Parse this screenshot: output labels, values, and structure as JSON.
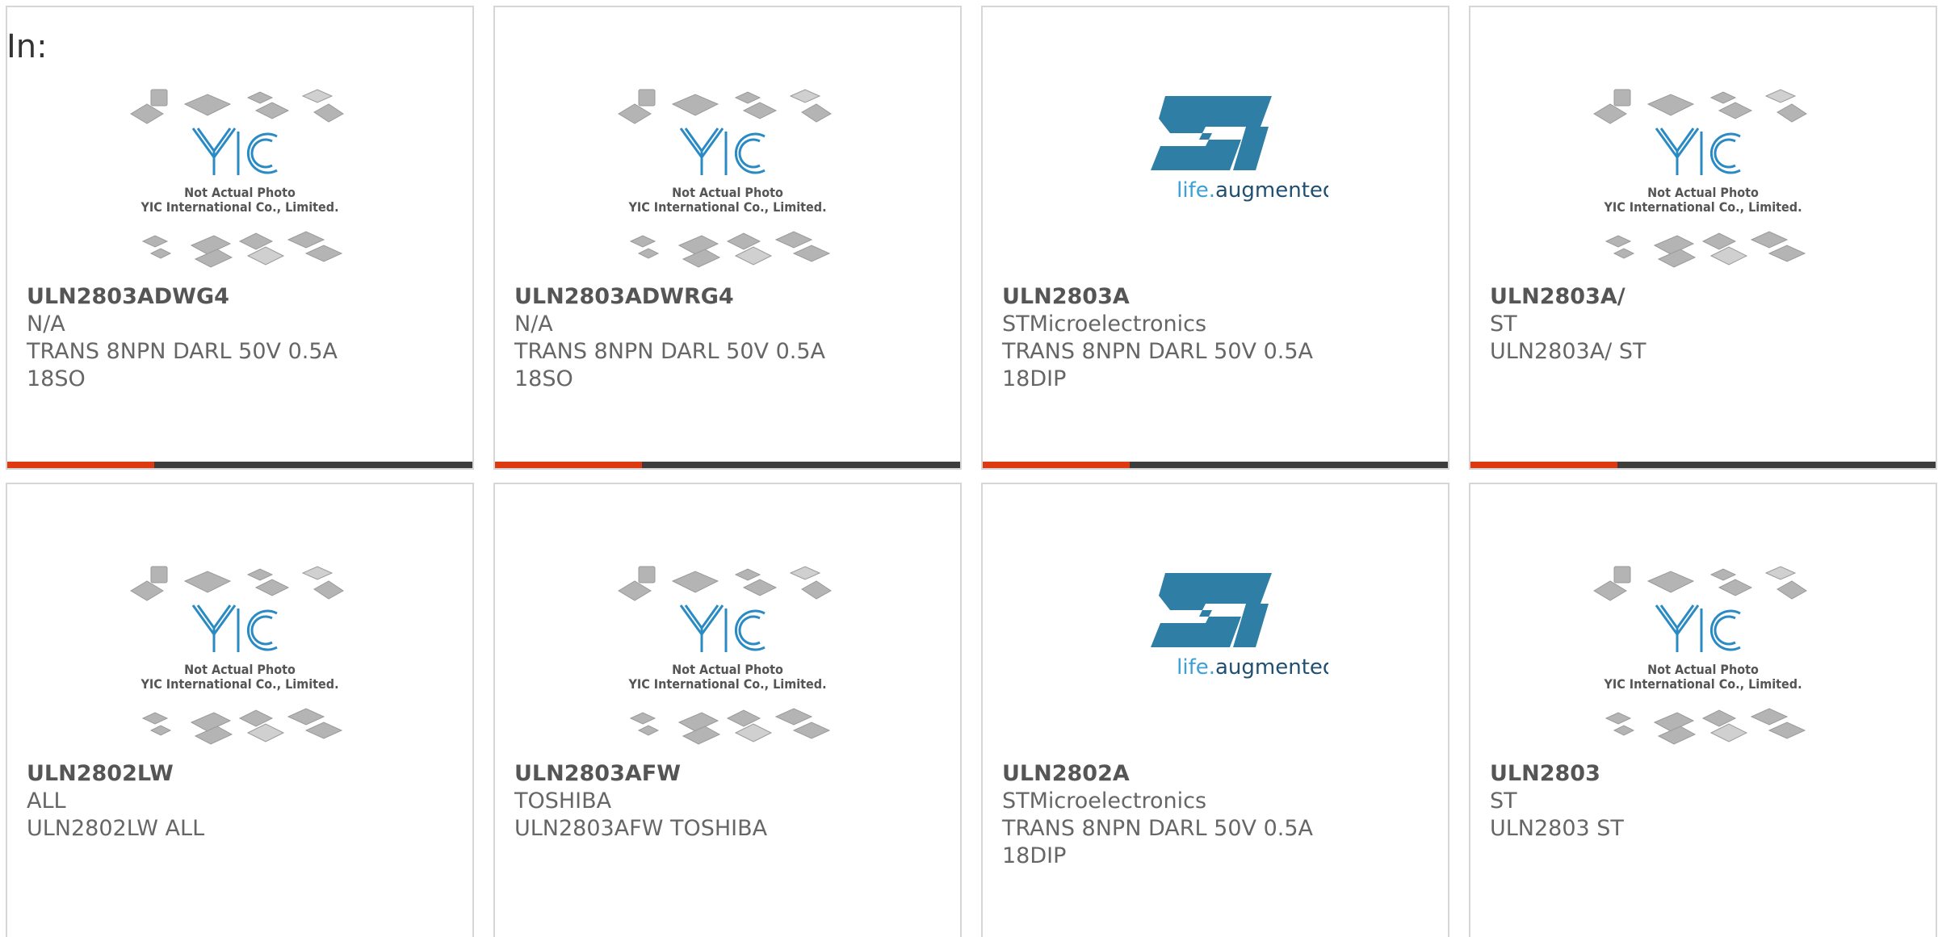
{
  "heading": "In:",
  "placeholder": {
    "brand": "YIC",
    "line1": "Not Actual Photo",
    "line2": "YIC International Co., Limited."
  },
  "st_logo": {
    "brand": "ST",
    "tagline_a": "life.",
    "tagline_b": "augmented"
  },
  "colors": {
    "accent": "#de3a12",
    "bar": "#3d3d3d",
    "st_blue": "#2f7ea5",
    "yic_blue": "#2a8ac4"
  },
  "products": [
    {
      "part": "ULN2803ADWG4",
      "mfr": "N/A",
      "desc1": "TRANS 8NPN DARL 50V 0.5A",
      "desc2": "18SO",
      "image": "yic"
    },
    {
      "part": "ULN2803ADWRG4",
      "mfr": "N/A",
      "desc1": "TRANS 8NPN DARL 50V 0.5A",
      "desc2": "18SO",
      "image": "yic"
    },
    {
      "part": "ULN2803A",
      "mfr": "STMicroelectronics",
      "desc1": "TRANS 8NPN DARL 50V 0.5A",
      "desc2": "18DIP",
      "image": "st"
    },
    {
      "part": "ULN2803A/",
      "mfr": "ST",
      "desc1": "ULN2803A/ ST",
      "desc2": "",
      "image": "yic"
    },
    {
      "part": "ULN2802LW",
      "mfr": "ALL",
      "desc1": "ULN2802LW ALL",
      "desc2": "",
      "image": "yic"
    },
    {
      "part": "ULN2803AFW",
      "mfr": "TOSHIBA",
      "desc1": "ULN2803AFW TOSHIBA",
      "desc2": "",
      "image": "yic"
    },
    {
      "part": "ULN2802A",
      "mfr": "STMicroelectronics",
      "desc1": "TRANS 8NPN DARL 50V 0.5A",
      "desc2": "18DIP",
      "image": "st"
    },
    {
      "part": "ULN2803",
      "mfr": "ST",
      "desc1": "ULN2803 ST",
      "desc2": "",
      "image": "yic"
    }
  ]
}
